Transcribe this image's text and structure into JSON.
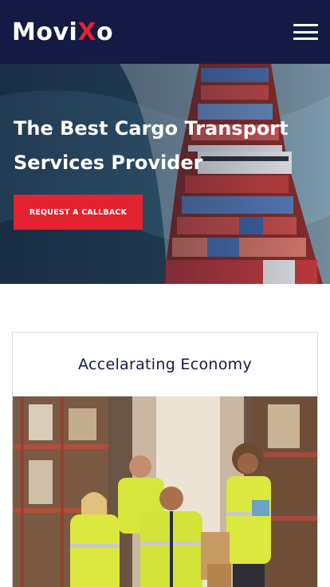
{
  "header": {
    "logo": {
      "part1": "Movi",
      "accent": "X",
      "part2": "o"
    },
    "menu_icon": "hamburger-menu-icon"
  },
  "hero": {
    "title": "The Best Cargo Transport Services Provider",
    "cta_label": "REQUEST A CALLBACK",
    "image": "container-ship-aerial-photo"
  },
  "card": {
    "title": "Accelarating Economy",
    "image": "warehouse-workers-photo"
  },
  "colors": {
    "navy": "#141a44",
    "accent_red": "#e3232f",
    "white": "#ffffff"
  }
}
